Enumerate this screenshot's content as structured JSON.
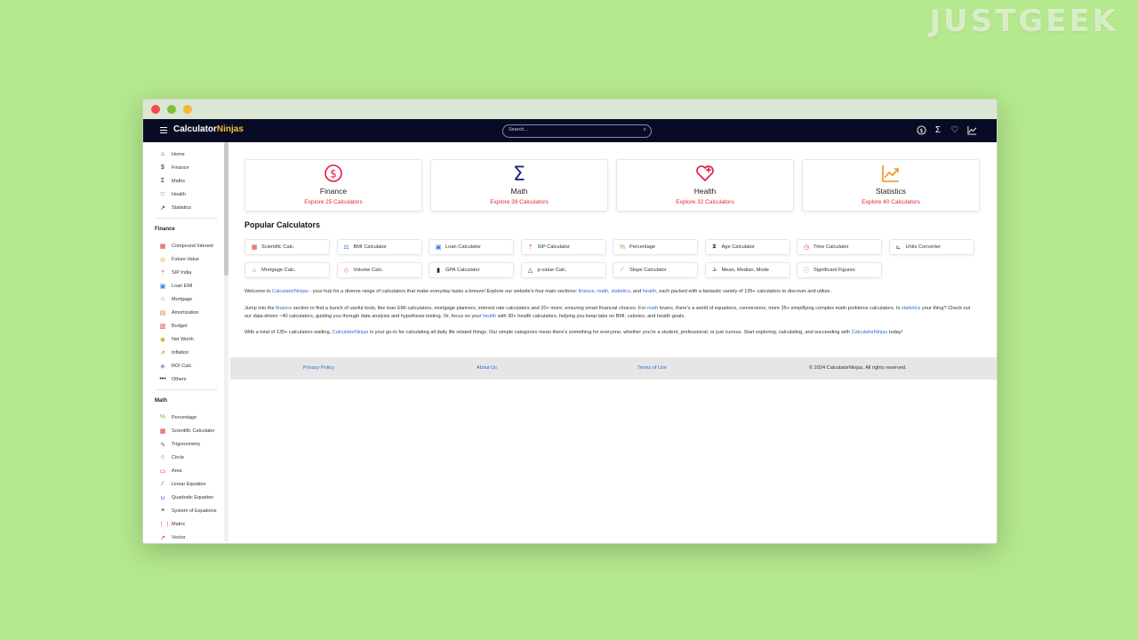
{
  "watermark": "JUSTGEEK",
  "nav": {
    "logo_part1": "Calculator",
    "logo_part2": "Ninjas",
    "search_placeholder": "Search...",
    "icons": [
      "dollar-icon",
      "sigma-icon",
      "heart-icon",
      "chart-icon"
    ]
  },
  "sidebar": {
    "top": [
      {
        "label": "Home",
        "icon": "home-icon"
      },
      {
        "label": "Finance",
        "icon": "dollar-icon"
      },
      {
        "label": "Maths",
        "icon": "sigma-icon"
      },
      {
        "label": "Health",
        "icon": "heart-icon"
      },
      {
        "label": "Statistics",
        "icon": "chart-icon"
      }
    ],
    "finance_title": "Finance",
    "finance": [
      {
        "label": "Compound Interest",
        "icon": "calc-icon"
      },
      {
        "label": "Future Value",
        "icon": "coins-icon"
      },
      {
        "label": "SIP India",
        "icon": "sip-icon"
      },
      {
        "label": "Loan EMI",
        "icon": "loan-icon"
      },
      {
        "label": "Mortgage",
        "icon": "house-icon"
      },
      {
        "label": "Amortization",
        "icon": "table-icon"
      },
      {
        "label": "Budget",
        "icon": "budget-icon"
      },
      {
        "label": "Net Worth",
        "icon": "coin-icon"
      },
      {
        "label": "Inflation",
        "icon": "inflation-icon"
      },
      {
        "label": "ROI Calc.",
        "icon": "roi-icon"
      },
      {
        "label": "Others",
        "icon": "more-icon"
      }
    ],
    "math_title": "Math",
    "math": [
      {
        "label": "Percentage",
        "icon": "percent-icon"
      },
      {
        "label": "Scientific Calculator",
        "icon": "calc-icon"
      },
      {
        "label": "Trigonometry",
        "icon": "wave-icon"
      },
      {
        "label": "Circle",
        "icon": "circle-icon"
      },
      {
        "label": "Area",
        "icon": "area-icon"
      },
      {
        "label": "Linear Equation",
        "icon": "line-icon"
      },
      {
        "label": "Quadratic Equation",
        "icon": "parabola-icon"
      },
      {
        "label": "System of Equations",
        "icon": "system-icon"
      },
      {
        "label": "Matrix",
        "icon": "matrix-icon"
      },
      {
        "label": "Vector",
        "icon": "vector-icon"
      }
    ]
  },
  "categories": [
    {
      "title": "Finance",
      "link": "Explore 25 Calculators",
      "icon": "dollar-icon",
      "color": "#e0183f"
    },
    {
      "title": "Math",
      "link": "Explore 39 Calculators",
      "icon": "sigma-icon",
      "color": "#1c2a7a"
    },
    {
      "title": "Health",
      "link": "Explore 32 Calculators",
      "icon": "heart-icon",
      "color": "#e0183f"
    },
    {
      "title": "Statistics",
      "link": "Explore 40 Calculators",
      "icon": "chart-icon",
      "color": "#f0921f"
    }
  ],
  "popular_title": "Popular Calculators",
  "popular": [
    {
      "label": "Scientific Calc.",
      "icon": "calc-icon"
    },
    {
      "label": "BMI Calculator",
      "icon": "scale-icon"
    },
    {
      "label": "Loan Calculator",
      "icon": "loan-icon"
    },
    {
      "label": "SIP Calculator",
      "icon": "sip-icon"
    },
    {
      "label": "Percentage",
      "icon": "percent-icon"
    },
    {
      "label": "Age Calculator",
      "icon": "hourglass-icon"
    },
    {
      "label": "Time Calculator",
      "icon": "clock-icon"
    },
    {
      "label": "Units Converter",
      "icon": "ruler-icon"
    },
    {
      "label": "Mortgage Calc.",
      "icon": "house-icon"
    },
    {
      "label": "Volume Calc.",
      "icon": "cube-icon"
    },
    {
      "label": "GPA Calculator",
      "icon": "book-icon"
    },
    {
      "label": "p-value Calc.",
      "icon": "triangle-icon"
    },
    {
      "label": "Slope Calculator",
      "icon": "slope-icon"
    },
    {
      "label": "Mean, Median, Mode",
      "icon": "stats-icon"
    },
    {
      "label": "Significant Figures",
      "icon": "figures-icon"
    }
  ],
  "para1": {
    "t1": "Welcome to ",
    "l1": "CalculatorNinjas",
    "t2": " - your hub for a diverse range of calculators that make everyday tasks a breeze! Explore our website's four main sections: ",
    "l2": "finance",
    "t3": ", ",
    "l3": "math",
    "t4": ", ",
    "l4": "statistics",
    "t5": ", and ",
    "l5": "health",
    "t6": ", each packed with a fantastic variety of 135+ calculators to discover and utilize."
  },
  "para2": {
    "t1": "Jump into the ",
    "l1": "finance",
    "t2": " section to find a bunch of useful tools, like loan EMI calculators, mortgage planners, interest rate calculators and 20+ more, ensuring smart financial choices. For ",
    "l2": "math",
    "t3": " lovers, there's a world of equations, conversions, more 35+ simplifying complex math problems calculators. Is ",
    "l3": "statistics",
    "t4": " your thing? Check out our data-driven ~40 calculators, guiding you through data analysis and hypothesis testing. Or, focus on your ",
    "l4": "health",
    "t5": " with 30+ health calculators, helping you keep tabs on BMI, calories, and health goals."
  },
  "para3": {
    "t1": "With a total of 135+ calculators waiting, ",
    "l1": "CalculatorNinjas",
    "t2": " is your go-to for calculating all daily life related things. Our simple categories mean there's something for everyone, whether you're a student, professional, or just curious. Start exploring, calculating, and succeeding with ",
    "l2": "CalculatorNinjas",
    "t3": " today!"
  },
  "footer": {
    "privacy": "Privacy Policy",
    "about": "About Us",
    "terms": "Terms of Use",
    "copyright": "© 2024 CalculatorNinjas. All rights reserved."
  }
}
